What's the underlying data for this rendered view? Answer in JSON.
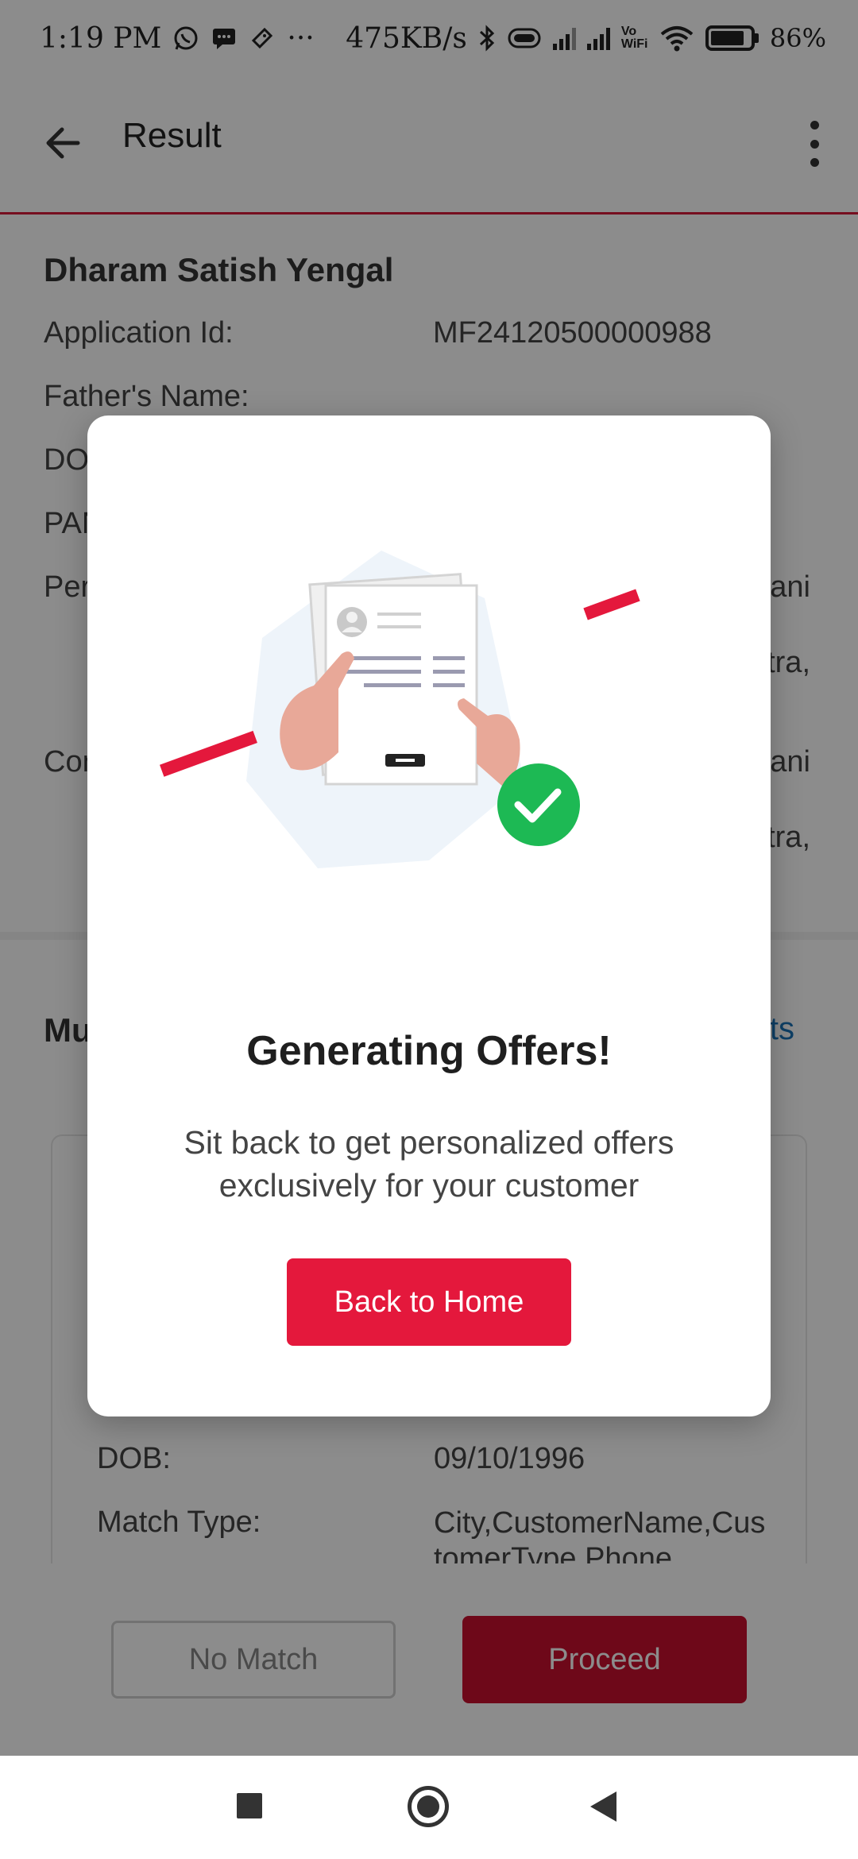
{
  "status_bar": {
    "time": "1:19 PM",
    "more": "···",
    "network_speed": "475KB/s",
    "vowifi": "Vo WiFi",
    "battery": "86%"
  },
  "app_bar": {
    "title": "Result",
    "back_icon": "arrow-left-icon",
    "menu_icon": "more-vert-icon"
  },
  "customer": {
    "name": "Dharam Satish Yengal",
    "application_id_label": "Application Id:",
    "application_id": "MF24120500000988",
    "father_name_label": "Father's Name:",
    "dob_label_partial": "DO",
    "pan_label_partial": "PAN",
    "permanent_label_partial": "Per",
    "communication_label_partial": "Con",
    "addr_trail_1": "ani",
    "addr_trail_2": "tra,",
    "addr_trail_3": "ani",
    "addr_trail_4": "tra,"
  },
  "matches_section": {
    "title_partial": "Mu",
    "link_partial": "ts"
  },
  "match_card": {
    "dob_label": "DOB:",
    "dob_value": "09/10/1996",
    "match_type_label": "Match Type:",
    "match_type_value_line1": "City,CustomerName,Cus",
    "match_type_value_line2": "tomerType,Phone"
  },
  "actions": {
    "no_match_label": "No Match",
    "proceed_label": "Proceed"
  },
  "dialog": {
    "title": "Generating Offers!",
    "description": "Sit back to get personalized offers exclusively for your customer",
    "button_label": "Back to Home",
    "accent_color": "#e4183c",
    "success_color": "#1db954"
  },
  "nav_bar": {
    "recents_icon": "square-icon",
    "home_icon": "circle-home-icon",
    "back_icon": "triangle-back-icon"
  }
}
